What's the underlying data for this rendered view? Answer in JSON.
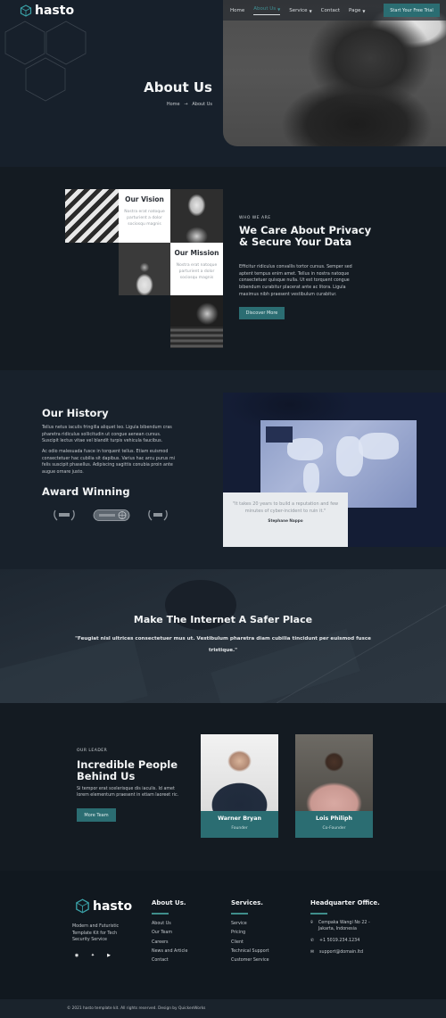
{
  "brand": {
    "name": "hasto",
    "accent": "#2b6d72",
    "accent_light": "#3f8e92",
    "background": "#161e27"
  },
  "nav": {
    "items": [
      {
        "label": "Home",
        "has_dropdown": false,
        "active": false
      },
      {
        "label": "About Us",
        "has_dropdown": true,
        "active": true
      },
      {
        "label": "Service",
        "has_dropdown": true,
        "active": false
      },
      {
        "label": "Contact",
        "has_dropdown": false,
        "active": false
      },
      {
        "label": "Page",
        "has_dropdown": true,
        "active": false
      }
    ],
    "cta_label": "Start Your Free Trial"
  },
  "hero": {
    "title": "About Us",
    "breadcrumb": {
      "home": "Home",
      "separator": "→",
      "current": "About Us"
    }
  },
  "about": {
    "vision": {
      "title": "Our Vision",
      "text": "Nostra erat natoque parturient a dolor sociosqu magnis"
    },
    "mission": {
      "title": "Our Mission",
      "text": "Nostra erat natoque parturient a dolor sociosqu magnis"
    },
    "eyebrow": "WHO WE ARE",
    "heading": "We Care About Privacy & Secure Your Data",
    "body": "Efficitur ridiculus convallis tortor cursus. Semper sed aptent tempus enim amet. Tellus in nostra natoque consectetuer quisque nulla. Ut est torquent congue bibendum curabitur placerat ante ac litora. Ligula maximus nibh praesent vestibulum curabitur.",
    "button_label": "Discover More"
  },
  "history": {
    "heading": "Our History",
    "paragraph_1": "Tellus netus iaculis fringilla aliquet leo. Ligula bibendum cras pharetra ridiculus sollicitudin ut congue aenean cursus. Suscipit lectus vitae vel blandit turpis vehicula faucibus.",
    "paragraph_2": "Ac odio malesuada fusce in torquent tellus. Etiam euismod consectetuer hac cubilia sit dapibus. Varius hac arcu purus mi felis suscipit phasellus. Adipiscing sagittis conubia proin ante augue ornare justo.",
    "awards_heading": "Award Winning",
    "awards": [
      "ULTRA",
      "ETERNO",
      "BEST"
    ],
    "quote": "\"It takes 20 years to build a reputation and few minutes of cyber-incident to ruin it.\"",
    "quote_author": "Stephane Nappo"
  },
  "banner": {
    "heading": "Make The Internet A Safer Place",
    "quote": "\"Feugiat nisl ultrices consectetuer mus ut. Vestibulum pharetra diam cubilia tincidunt per euismod fusce tristique.\""
  },
  "team": {
    "eyebrow": "OUR LEADER",
    "heading": "Incredible People Behind Us",
    "body": "Si tempor erat scelerisque dis iaculis. Id amet lorem elementum praesent in etiam laoreet ric.",
    "button_label": "More Team",
    "members": [
      {
        "name": "Warner Bryan",
        "role": "Founder"
      },
      {
        "name": "Lois Philiph",
        "role": "Co-Founder"
      }
    ]
  },
  "footer": {
    "tagline": "Modern and Futuristic Template Kit for Tech Security Service",
    "social_icons": [
      "dribbble-icon",
      "twitter-icon",
      "youtube-icon"
    ],
    "about": {
      "title": "About Us.",
      "links": [
        "About Us",
        "Our Team",
        "Careers",
        "News and Article",
        "Contact"
      ]
    },
    "services": {
      "title": "Services.",
      "links": [
        "Service",
        "Pricing",
        "Client",
        "Technical Support",
        "Customer Service"
      ]
    },
    "hq": {
      "title": "Headquarter Office.",
      "address": "Cempaka Wangi No 22 - Jakarta, Indonesia",
      "phone": "+1 5019.234.1234",
      "email": "support@domain.ltd"
    },
    "copyright": "© 2021 hasto template kit. All rights reserved. Design by QuickenWorks"
  }
}
